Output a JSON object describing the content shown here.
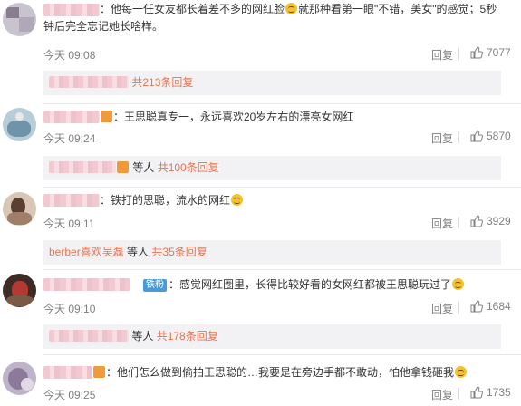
{
  "comments": [
    {
      "content_a": "：他每一任女友都长着差不多的网红脸",
      "content_b": "就那种看第一眼\"不错，美女\"的感觉；5秒钟后完全忘记她长啥样。",
      "time": "今天 09:08",
      "reply_label": "回复",
      "like_count": "7077",
      "thread_who": "",
      "thread_link": "共213条回复",
      "avatar_icon": "avatar-icon"
    },
    {
      "content_a": "：王思聪真专一，永远喜欢20岁左右的漂亮女网红",
      "time": "今天 09:24",
      "reply_label": "回复",
      "like_count": "5870",
      "thread_who": "等人",
      "thread_link": "共100条回复"
    },
    {
      "content_a": "：铁打的思聪，流水的网红",
      "time": "今天 09:11",
      "reply_label": "回复",
      "like_count": "3929",
      "thread_name": "berber喜欢吴磊",
      "thread_who": "等人",
      "thread_link": "共35条回复"
    },
    {
      "badge": "铁粉",
      "content_a": "：感觉网红圈里，长得比较好看的女网红都被王思聪玩过了",
      "time": "今天 09:10",
      "reply_label": "回复",
      "like_count": "1684",
      "thread_who": "等人",
      "thread_link": "共178条回复"
    },
    {
      "content_a": "：他们怎么做到偷拍王思聪的…我要是在旁边手都不敢动，怕他拿钱砸我",
      "time": "今天 09:25",
      "reply_label": "回复",
      "like_count": "1735"
    }
  ],
  "colors": {
    "link": "#eb7350",
    "badge": "#4a9bd5",
    "muted": "#808080",
    "reply_bg": "#f2f2f5"
  },
  "icons": [
    "avatar-icon",
    "thumbs-up-icon",
    "laughing-emoji-icon",
    "angry-emoji-icon",
    "thinking-emoji-icon",
    "gift-icon"
  ]
}
